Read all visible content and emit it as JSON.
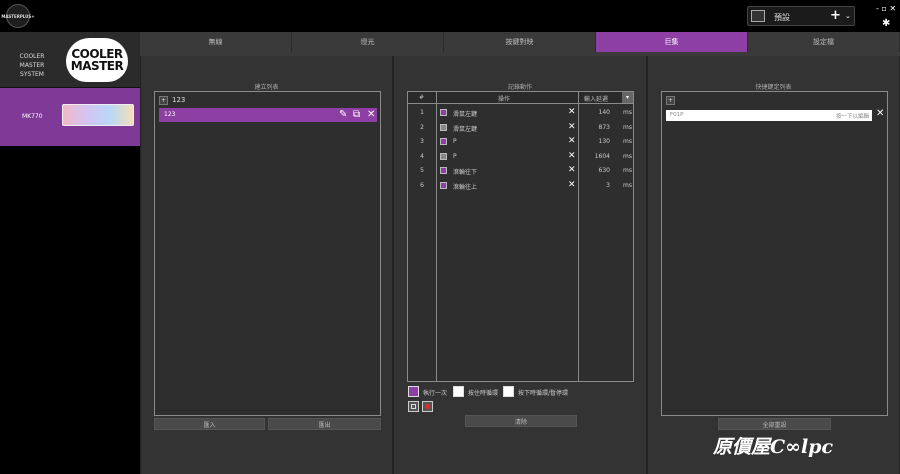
{
  "app": {
    "logo_text": "MASTERPLUS+"
  },
  "profile": {
    "name": "預設",
    "add_label": "+",
    "dropdown_label": "⌄"
  },
  "window": {
    "controls": "- ▫ ✕",
    "settings": "✱"
  },
  "sidebar": {
    "system_label": "COOLER MASTER SYSTEM",
    "brand_logo": [
      "COOLER",
      "MASTER"
    ],
    "device_label": "MK770"
  },
  "tabs": [
    {
      "label": "無線",
      "active": false
    },
    {
      "label": "燈光",
      "active": false
    },
    {
      "label": "按鍵對映",
      "active": false
    },
    {
      "label": "巨集",
      "active": true
    },
    {
      "label": "設定檔",
      "active": false
    }
  ],
  "macro_panel": {
    "title": "建立列表",
    "new_label": "+",
    "name": "123",
    "selected_macro": "123",
    "import_label": "匯入",
    "export_label": "匯出"
  },
  "record_panel": {
    "title": "記錄動作",
    "columns": {
      "num": "#",
      "action": "操作",
      "delay": "輸入延遲"
    },
    "sort_icon": "▾",
    "rows": [
      {
        "num": "1",
        "icon": "purple",
        "action": "滑鼠左鍵",
        "value": "140",
        "unit": "ms"
      },
      {
        "num": "2",
        "icon": "gray",
        "action": "滑鼠左鍵",
        "value": "873",
        "unit": "ms"
      },
      {
        "num": "3",
        "icon": "purple",
        "action": "P",
        "value": "130",
        "unit": "ms"
      },
      {
        "num": "4",
        "icon": "gray",
        "action": "P",
        "value": "1604",
        "unit": "ms"
      },
      {
        "num": "5",
        "icon": "purple",
        "action": "滾輪往下",
        "value": "630",
        "unit": "ms"
      },
      {
        "num": "6",
        "icon": "purple",
        "action": "滾輪往上",
        "value": "3",
        "unit": "ms"
      }
    ],
    "options": [
      {
        "label": "執行一次",
        "selected": true
      },
      {
        "label": "按住時循環",
        "selected": false
      },
      {
        "label": "按下時循環/暫停環",
        "selected": false
      }
    ],
    "clear_label": "清除"
  },
  "keybind_panel": {
    "title": "快捷鍵定列表",
    "new_label": "+",
    "row_key": "F01P",
    "row_hint": "按一下以編輯",
    "reset_label": "全部重設"
  },
  "watermark": "原價屋C∞lpc",
  "colors": {
    "accent": "#8d3fa4",
    "panel": "#333333",
    "background": "#000000"
  }
}
